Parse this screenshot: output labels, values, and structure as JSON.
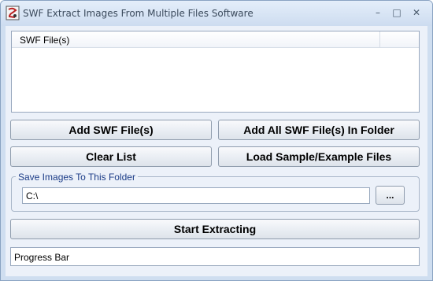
{
  "window": {
    "title": "SWF Extract Images From Multiple Files Software",
    "controls": {
      "minimize": "–",
      "maximize": "□",
      "close": "✕"
    }
  },
  "file_list": {
    "columns": [
      "SWF File(s)"
    ],
    "rows": []
  },
  "buttons": {
    "add_files": "Add SWF File(s)",
    "add_all_in_folder": "Add All SWF File(s) In Folder",
    "clear_list": "Clear List",
    "load_sample": "Load Sample/Example Files",
    "browse": "...",
    "start": "Start Extracting"
  },
  "output_folder": {
    "legend": "Save Images To This Folder",
    "value": "C:\\"
  },
  "progress": {
    "label": "Progress Bar",
    "percent": 0
  },
  "colors": {
    "legend_text": "#1b3c87",
    "window_frame": "#cfdef0"
  }
}
